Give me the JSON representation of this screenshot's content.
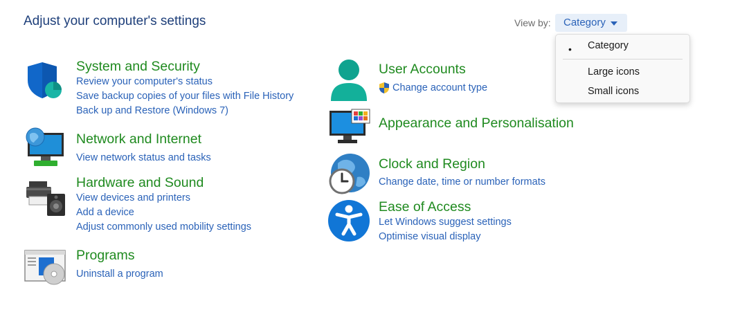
{
  "page": {
    "title": "Adjust your computer's settings"
  },
  "viewby": {
    "label": "View by:",
    "selected": "Category",
    "options": [
      {
        "label": "Category",
        "selected": true
      },
      {
        "label": "Large icons",
        "selected": false
      },
      {
        "label": "Small icons",
        "selected": false
      }
    ],
    "bullet": "•"
  },
  "colors": {
    "title_blue": "#1e3f7a",
    "category_green": "#1f8a1f",
    "link_blue": "#2a62b8"
  },
  "categories": {
    "system": {
      "icon": "shield-icon",
      "title": "System and Security",
      "links": [
        "Review your computer's status",
        "Save backup copies of your files with File History",
        "Back up and Restore (Windows 7)"
      ]
    },
    "network": {
      "icon": "network-globe-icon",
      "title": "Network and Internet",
      "links": [
        "View network status and tasks"
      ]
    },
    "hardware": {
      "icon": "printer-speaker-icon",
      "title": "Hardware and Sound",
      "links": [
        "View devices and printers",
        "Add a device",
        "Adjust commonly used mobility settings"
      ]
    },
    "programs": {
      "icon": "programs-disc-icon",
      "title": "Programs",
      "links": [
        "Uninstall a program"
      ]
    },
    "users": {
      "icon": "user-icon",
      "title": "User Accounts",
      "links": [
        "Change account type"
      ]
    },
    "appearance": {
      "icon": "monitor-icon",
      "title": "Appearance and Personalisation",
      "links": []
    },
    "clock": {
      "icon": "clock-globe-icon",
      "title": "Clock and Region",
      "links": [
        "Change date, time or number formats"
      ]
    },
    "ease": {
      "icon": "accessibility-icon",
      "title": "Ease of Access",
      "links": [
        "Let Windows suggest settings",
        "Optimise visual display"
      ]
    }
  }
}
